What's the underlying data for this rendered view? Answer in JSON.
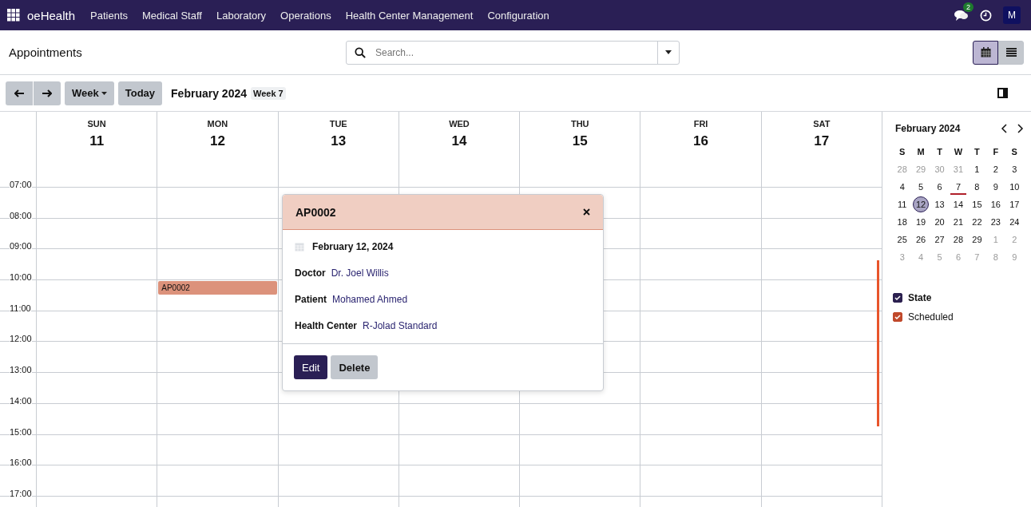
{
  "navbar": {
    "app_name": "oeHealth",
    "menu": [
      "Patients",
      "Medical Staff",
      "Laboratory",
      "Operations",
      "Health Center Management",
      "Configuration"
    ],
    "messages_badge": "2",
    "avatar": "M"
  },
  "control_panel": {
    "title": "Appointments",
    "search": {
      "placeholder": "Search..."
    },
    "views": [
      {
        "kind": "calendar",
        "selected": true
      },
      {
        "kind": "list",
        "selected": false
      }
    ]
  },
  "toolbar": {
    "scale": "Week",
    "today": "Today",
    "period": "February 2024",
    "week": "Week 7"
  },
  "days": [
    {
      "name": "SUN",
      "number": "11"
    },
    {
      "name": "MON",
      "number": "12",
      "events": [
        {
          "title": "AP0002"
        }
      ]
    },
    {
      "name": "TUE",
      "number": "13"
    },
    {
      "name": "WED",
      "number": "14"
    },
    {
      "name": "THU",
      "number": "15"
    },
    {
      "name": "FRI",
      "number": "16"
    },
    {
      "name": "SAT",
      "number": "17"
    }
  ],
  "hours": [
    "07:00",
    "08:00",
    "09:00",
    "10:00",
    "11:00",
    "12:00",
    "13:00",
    "14:00",
    "15:00",
    "16:00",
    "17:00"
  ],
  "popover": {
    "title": "AP0002",
    "date": "February 12, 2024",
    "fields": [
      {
        "label": "Doctor",
        "value": "Dr. Joel Willis"
      },
      {
        "label": "Patient",
        "value": "Mohamed Ahmed"
      },
      {
        "label": "Health Center",
        "value": "R-Jolad Standard"
      }
    ],
    "buttons": [
      "Edit",
      "Delete"
    ]
  },
  "mini_calendar": {
    "title": "February 2024",
    "weekdays": [
      "S",
      "M",
      "T",
      "W",
      "T",
      "F",
      "S"
    ],
    "weeks": [
      [
        {
          "d": "28",
          "muted": true,
          "today": false,
          "selected": false
        },
        {
          "d": "29",
          "muted": true,
          "today": false,
          "selected": false
        },
        {
          "d": "30",
          "muted": true,
          "today": false,
          "selected": false
        },
        {
          "d": "31",
          "muted": true,
          "today": false,
          "selected": false
        },
        {
          "d": "1",
          "muted": false,
          "today": false,
          "selected": false
        },
        {
          "d": "2",
          "muted": false,
          "today": false,
          "selected": false
        },
        {
          "d": "3",
          "muted": false,
          "today": false,
          "selected": false
        }
      ],
      [
        {
          "d": "4",
          "muted": false,
          "today": false,
          "selected": false
        },
        {
          "d": "5",
          "muted": false,
          "today": false,
          "selected": false
        },
        {
          "d": "6",
          "muted": false,
          "today": false,
          "selected": false
        },
        {
          "d": "7",
          "muted": false,
          "today": true,
          "selected": false
        },
        {
          "d": "8",
          "muted": false,
          "today": false,
          "selected": false
        },
        {
          "d": "9",
          "muted": false,
          "today": false,
          "selected": false
        },
        {
          "d": "10",
          "muted": false,
          "today": false,
          "selected": false
        }
      ],
      [
        {
          "d": "11",
          "muted": false,
          "today": false,
          "selected": false
        },
        {
          "d": "12",
          "muted": false,
          "today": false,
          "selected": true
        },
        {
          "d": "13",
          "muted": false,
          "today": false,
          "selected": false
        },
        {
          "d": "14",
          "muted": false,
          "today": false,
          "selected": false
        },
        {
          "d": "15",
          "muted": false,
          "today": false,
          "selected": false
        },
        {
          "d": "16",
          "muted": false,
          "today": false,
          "selected": false
        },
        {
          "d": "17",
          "muted": false,
          "today": false,
          "selected": false
        }
      ],
      [
        {
          "d": "18",
          "muted": false,
          "today": false,
          "selected": false
        },
        {
          "d": "19",
          "muted": false,
          "today": false,
          "selected": false
        },
        {
          "d": "20",
          "muted": false,
          "today": false,
          "selected": false
        },
        {
          "d": "21",
          "muted": false,
          "today": false,
          "selected": false
        },
        {
          "d": "22",
          "muted": false,
          "today": false,
          "selected": false
        },
        {
          "d": "23",
          "muted": false,
          "today": false,
          "selected": false
        },
        {
          "d": "24",
          "muted": false,
          "today": false,
          "selected": false
        }
      ],
      [
        {
          "d": "25",
          "muted": false,
          "today": false,
          "selected": false
        },
        {
          "d": "26",
          "muted": false,
          "today": false,
          "selected": false
        },
        {
          "d": "27",
          "muted": false,
          "today": false,
          "selected": false
        },
        {
          "d": "28",
          "muted": false,
          "today": false,
          "selected": false
        },
        {
          "d": "29",
          "muted": false,
          "today": false,
          "selected": false
        },
        {
          "d": "1",
          "muted": true,
          "today": false,
          "selected": false
        },
        {
          "d": "2",
          "muted": true,
          "today": false,
          "selected": false
        }
      ],
      [
        {
          "d": "3",
          "muted": true,
          "today": false,
          "selected": false
        },
        {
          "d": "4",
          "muted": true,
          "today": false,
          "selected": false
        },
        {
          "d": "5",
          "muted": true,
          "today": false,
          "selected": false
        },
        {
          "d": "6",
          "muted": true,
          "today": false,
          "selected": false
        },
        {
          "d": "7",
          "muted": true,
          "today": false,
          "selected": false
        },
        {
          "d": "8",
          "muted": true,
          "today": false,
          "selected": false
        },
        {
          "d": "9",
          "muted": true,
          "today": false,
          "selected": false
        }
      ]
    ]
  },
  "filters": [
    {
      "label": "State",
      "kind": "header",
      "checked": true,
      "color": "#2c2150"
    },
    {
      "label": "Scheduled",
      "kind": "item",
      "checked": true,
      "color": "#c0492b"
    }
  ]
}
